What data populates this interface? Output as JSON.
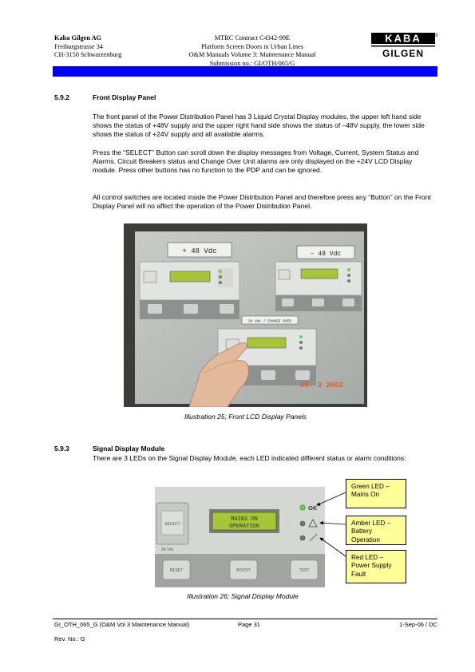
{
  "header": {
    "company": "Kaba Gilgen AG",
    "address1": "Freiburgstrasse 34",
    "address2": "CH-3150 Schwarzenburg",
    "contract": "MTRC Contract C4342-99E",
    "project": "Platform Screen Doors in Urban Lines",
    "manual": "O&M Manuals Volume 3: Maintenance Manual",
    "submission": "Submission no.: GI/OTH/065/G",
    "logo_top": "KABA",
    "logo_bottom": "GILGEN",
    "logo_mark": "®"
  },
  "section_592": {
    "number": "5.9.2",
    "title": "Front Display Panel",
    "p1": "The front panel of the Power Distribution Panel has 3 Liquid Crystal Display modules, the upper left hand side shows the status of +48V supply and the upper right hand side shows the status of –48V supply, the lower side shows the status of +24V supply and all available alarms.",
    "p2": "Press the “SELECT” Button can scroll down the display messages from Voltage, Current, System Status and Alarms. Circuit Breakers status and Change Over Unit alarms are only displayed on the +24V LCD Display module. Press other buttons has no function to the PDP and can be ignored.",
    "p3": "All control switches are located inside the Power Distribution Panel and therefore press any “Button” on the Front Display Panel will no affect the operation of the Power Distribution Panel."
  },
  "photo": {
    "label_left": "+ 48 Vdc",
    "label_right": "– 48 Vdc",
    "label_bottom": "24 Vdc / CHANGE OVER",
    "date_stamp": "09. 3 2002"
  },
  "caption1": "Illustration 25; Front LCD Display Panels",
  "section_593": {
    "number": "5.9.3",
    "title": "Signal Display Module",
    "p1": "There are 3 LEDs on the Signal Display Module, each LED indicated different status or alarm conditions:"
  },
  "module": {
    "select": "SELECT",
    "lcd_line1": "MAINS ON",
    "lcd_line2": "OPERATION",
    "ok": "OK",
    "reset": "RESET",
    "boost": "BOOST",
    "test": "TEST",
    "small_label": "24 Vdc"
  },
  "callouts": {
    "green": "Green LED – Mains On",
    "amber": "Amber LED – Battery Operation",
    "red": "Red LED – Power Supply Fault"
  },
  "caption2": "Illustration 26; Signal Display Module",
  "footer": {
    "doc": "GI_OTH_065_G (O&M Vol 3 Maintenance Manual)",
    "page": "Page 31",
    "date": "1-Sep-06 / DC",
    "rev": "Rev. No.: G"
  },
  "colors": {
    "header_bar": "#0000ee",
    "callout_fill": "#ffff99",
    "lcd_green": "#a8c43a",
    "led_green": "#5fd35f"
  }
}
